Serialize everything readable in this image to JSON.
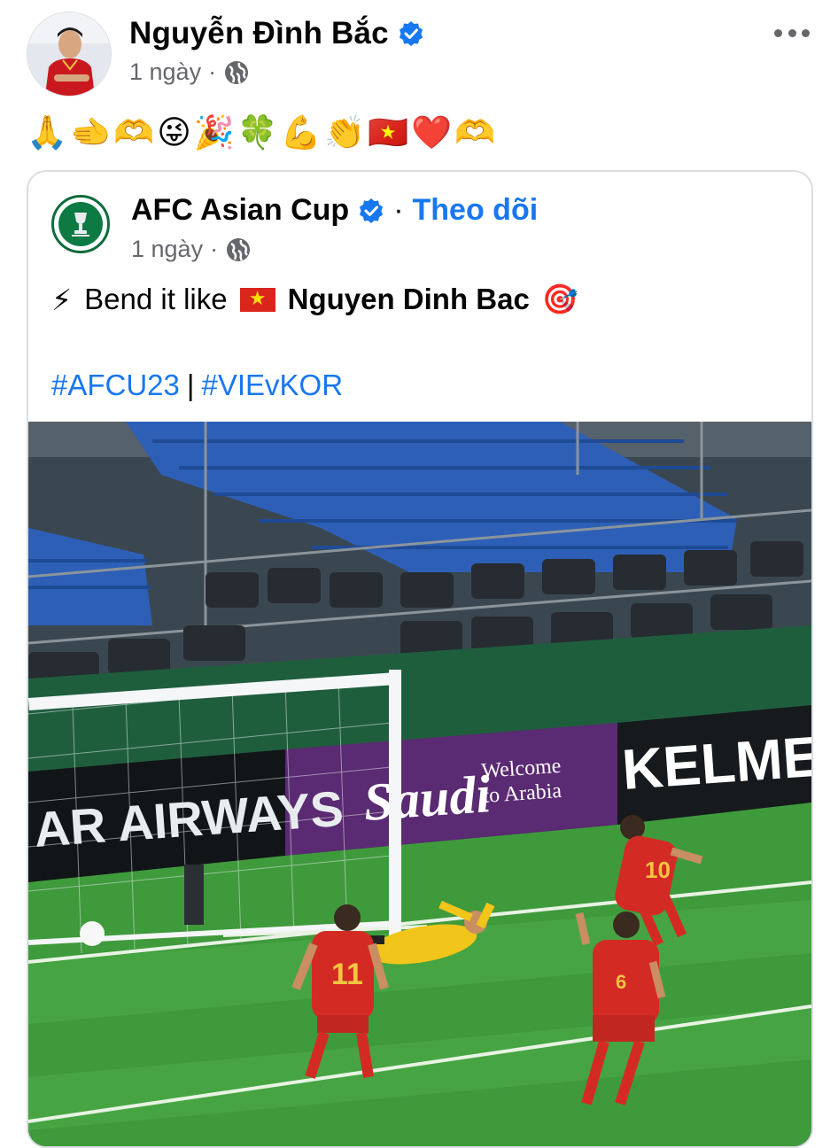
{
  "post": {
    "author": "Nguyễn Đình Bắc",
    "time": "1 ngày",
    "separator": "·",
    "emojis": "🙏🫲🫶😜🎉🍀💪👏🇻🇳❤️🫶",
    "more_icon": "more-horizontal-icon"
  },
  "shared_post": {
    "page_name": "AFC Asian Cup",
    "follow_label": "Theo dõi",
    "separator": "·",
    "time": "1 ngày",
    "text_prefix_emoji": "⚡",
    "text_main": "Bend it like",
    "text_name": "Nguyen Dinh Bac",
    "text_suffix_emoji": "🎯",
    "hashtag_1": "#AFCU23",
    "hashtag_separator": "|",
    "hashtag_2": "#VIEvKOR"
  },
  "video": {
    "ad_board_1": "AR AIRWAYS",
    "ad_board_2_brand": "Saudi",
    "ad_board_2_line1": "Welcome",
    "ad_board_2_line2": "to Arabia",
    "ad_board_3": "KELME",
    "player_number_1": "11",
    "player_number_2": "10",
    "player_number_3": "6"
  },
  "colors": {
    "link_blue": "#1877f2",
    "meta_gray": "#65676b",
    "verified_blue": "#1877f2",
    "pitch_green": "#3f9a3c",
    "seat_blue": "#2d5fb6",
    "kit_red": "#d42a24",
    "keeper_yellow": "#f2c51a"
  }
}
